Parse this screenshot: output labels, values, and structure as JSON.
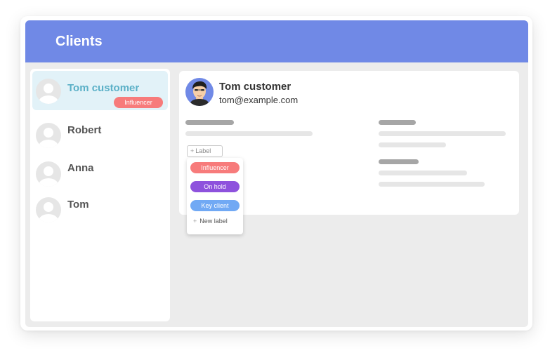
{
  "header": {
    "title": "Clients"
  },
  "clients": [
    {
      "name": "Tom customer",
      "label": "Influencer",
      "selected": true
    },
    {
      "name": "Robert",
      "selected": false
    },
    {
      "name": "Anna",
      "selected": false
    },
    {
      "name": "Tom",
      "selected": false
    }
  ],
  "detail": {
    "name": "Tom customer",
    "email": "tom@example.com",
    "label_button": "Label",
    "label_button_icon": "plus-icon"
  },
  "label_menu": {
    "options": [
      {
        "label": "Influencer",
        "color": "#f77b7b"
      },
      {
        "label": "On hold",
        "color": "#8e52dd"
      },
      {
        "label": "Key client",
        "color": "#71a9f4"
      }
    ],
    "new_label": "New label",
    "new_label_icon": "plus-icon"
  },
  "colors": {
    "header": "#7089e6",
    "selected_row": "#e2f2f8",
    "selected_text": "#5bb0c7",
    "influencer": "#f77b7b",
    "on_hold": "#8e52dd",
    "key_client": "#71a9f4"
  }
}
